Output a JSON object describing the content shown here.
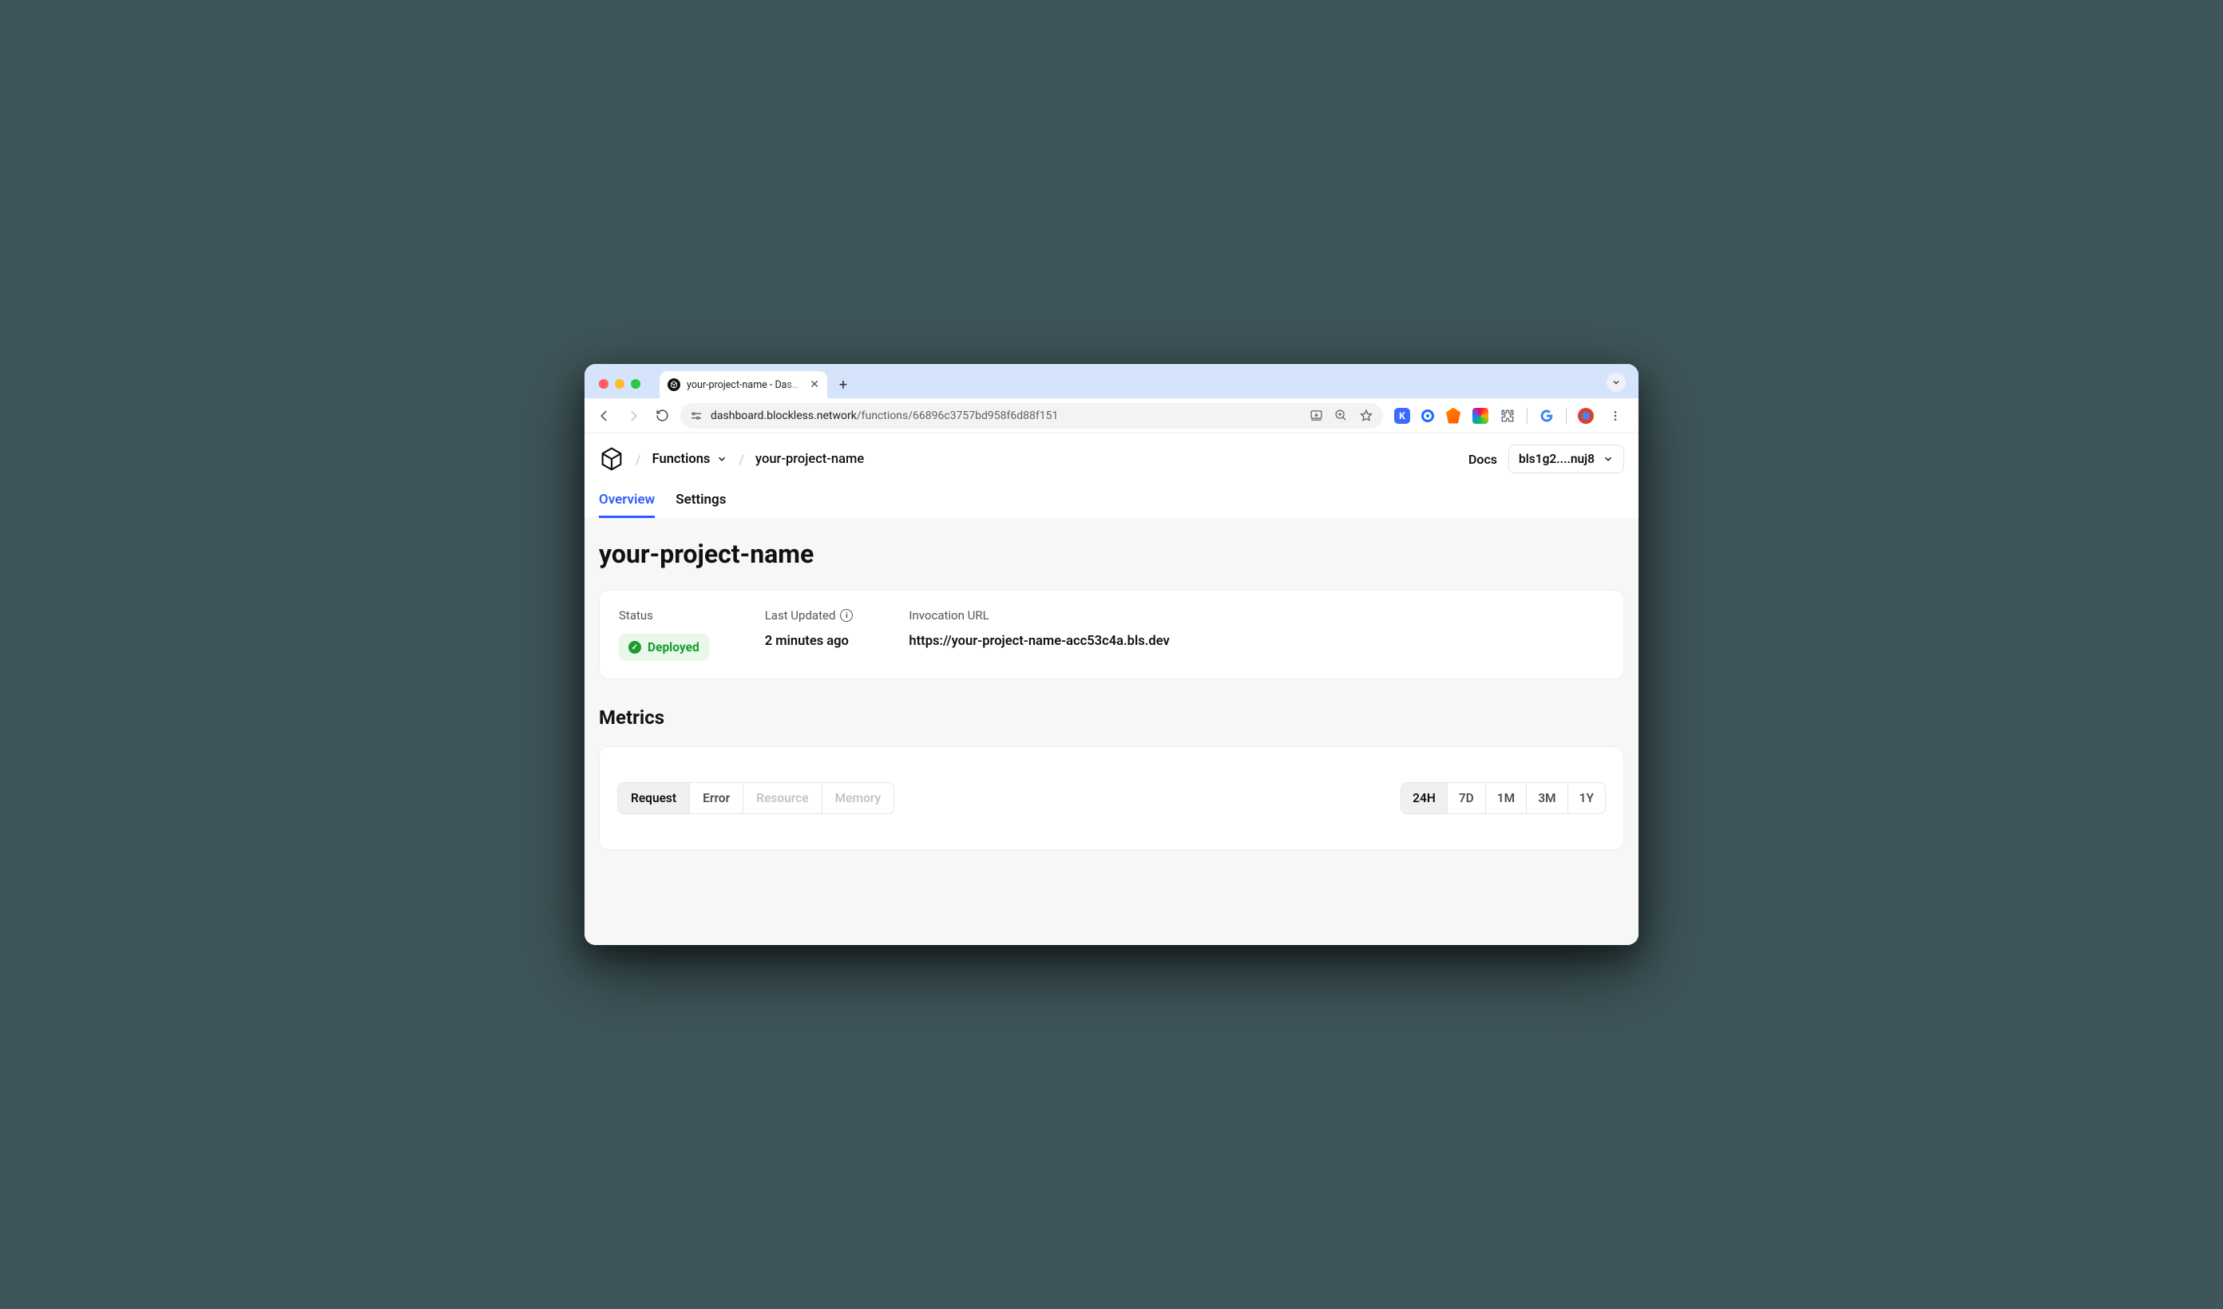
{
  "browser": {
    "tab_title": "your-project-name - Dashboard",
    "url_host": "dashboard.blockless.network",
    "url_path": "/functions/66896c3757bd958f6d88f151"
  },
  "header": {
    "breadcrumb_root": "Functions",
    "breadcrumb_project": "your-project-name",
    "docs_label": "Docs",
    "wallet_short": "bls1g2....nuj8"
  },
  "tabs": {
    "overview": "Overview",
    "settings": "Settings"
  },
  "project": {
    "title": "your-project-name",
    "status_label": "Status",
    "status_value": "Deployed",
    "last_updated_label": "Last Updated",
    "last_updated_value": "2 minutes ago",
    "invocation_label": "Invocation URL",
    "invocation_value": "https://your-project-name-acc53c4a.bls.dev"
  },
  "metrics": {
    "heading": "Metrics",
    "tabs": [
      "Request",
      "Error",
      "Resource",
      "Memory"
    ],
    "time": [
      "24H",
      "7D",
      "1M",
      "3M",
      "1Y"
    ]
  }
}
